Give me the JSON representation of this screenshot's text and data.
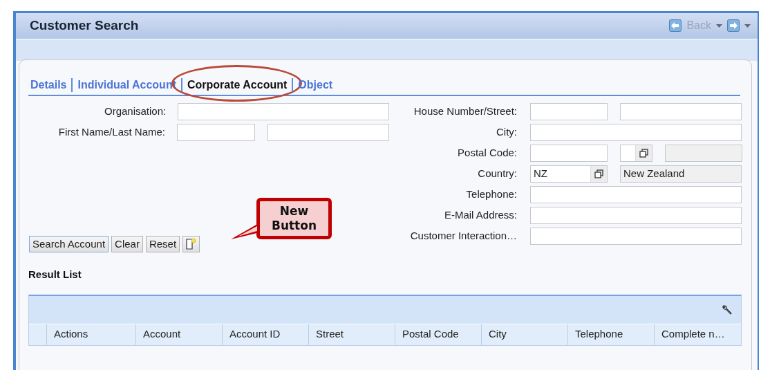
{
  "window": {
    "title": "Customer Search"
  },
  "nav": {
    "back": {
      "label": "Back",
      "disabled": true
    },
    "forward": {
      "disabled": false
    }
  },
  "tabs": [
    {
      "label": "Details",
      "selected": false,
      "highlighted": false
    },
    {
      "label": "Individual Account",
      "selected": false,
      "highlighted": false
    },
    {
      "label": "Corporate Account",
      "selected": true,
      "highlighted": true
    },
    {
      "label": "Object",
      "selected": false,
      "highlighted": false
    }
  ],
  "form": {
    "left": [
      {
        "label": "Organisation:",
        "kind": "single"
      },
      {
        "label": "First Name/Last Name:",
        "kind": "pair"
      }
    ],
    "right": [
      {
        "label": "House Number/Street:",
        "kind": "pair"
      },
      {
        "label": "City:",
        "kind": "single"
      },
      {
        "label": "Postal Code:",
        "kind": "postal"
      },
      {
        "label": "Country:",
        "kind": "country",
        "value": "NZ",
        "description": "New Zealand"
      },
      {
        "label": "Telephone:",
        "kind": "single"
      },
      {
        "label": "E-Mail Address:",
        "kind": "single"
      },
      {
        "label": "Customer Interaction…",
        "kind": "single"
      }
    ]
  },
  "buttons": [
    {
      "kind": "text",
      "label": "Search Account",
      "default": true
    },
    {
      "kind": "text",
      "label": "Clear",
      "default": false
    },
    {
      "kind": "text",
      "label": "Reset",
      "default": false
    },
    {
      "kind": "new",
      "default": false
    }
  ],
  "callout": {
    "text": "New Button"
  },
  "result_list": {
    "title": "Result List",
    "columns": [
      "Actions",
      "Account",
      "Account ID",
      "Street",
      "Postal Code",
      "City",
      "Telephone",
      "Complete n…"
    ]
  }
}
